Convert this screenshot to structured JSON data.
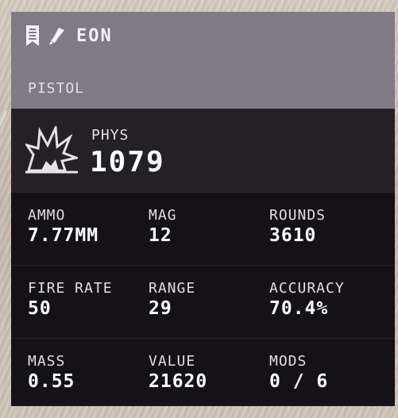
{
  "weapon": {
    "name": "EON",
    "category": "PISTOL",
    "icons": [
      "banner-icon",
      "rocket-icon"
    ]
  },
  "damage": {
    "icon": "physical-damage-icon",
    "type": "PHYS",
    "value": "1079"
  },
  "stats": [
    [
      {
        "label": "AMMO",
        "value": "7.77MM"
      },
      {
        "label": "MAG",
        "value": "12"
      },
      {
        "label": "ROUNDS",
        "value": "3610"
      }
    ],
    [
      {
        "label": "FIRE RATE",
        "value": "50"
      },
      {
        "label": "RANGE",
        "value": "29"
      },
      {
        "label": "ACCURACY",
        "value": "70.4%"
      }
    ],
    [
      {
        "label": "MASS",
        "value": "0.55"
      },
      {
        "label": "VALUE",
        "value": "21620"
      },
      {
        "label": "MODS",
        "value": "0 / 6"
      }
    ]
  ],
  "colors": {
    "header": "#807a85",
    "damage_panel": "#242126",
    "stats_panel": "#141216",
    "text": "#ffffff"
  }
}
